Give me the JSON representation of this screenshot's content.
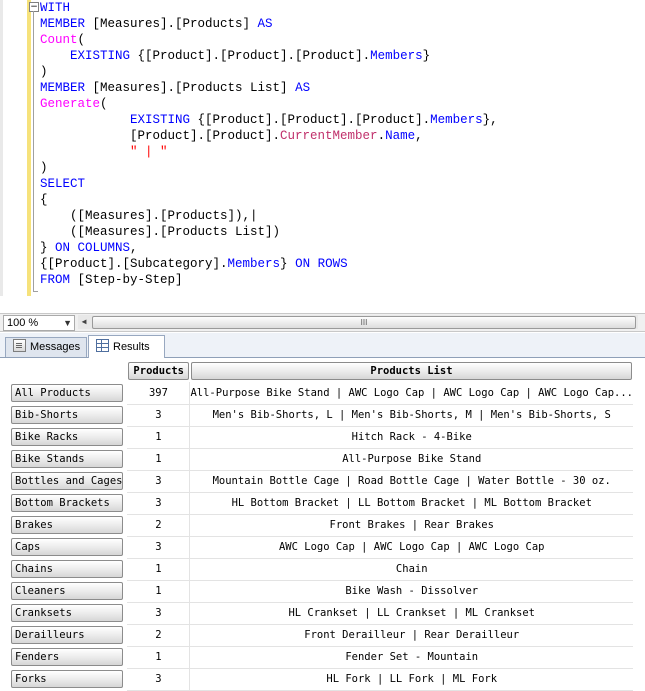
{
  "editor": {
    "fold_symbol": "−",
    "lines": [
      [
        {
          "t": "WITH",
          "c": "kw"
        }
      ],
      [
        {
          "t": "MEMBER",
          "c": "kw"
        },
        {
          "t": " [Measures].[Products] "
        },
        {
          "t": "AS",
          "c": "kw"
        }
      ],
      [
        {
          "t": "Count",
          "c": "fn"
        },
        {
          "t": "("
        }
      ],
      [
        {
          "t": "    "
        },
        {
          "t": "EXISTING",
          "c": "kw"
        },
        {
          "t": " {[Product].[Product].[Product]."
        },
        {
          "t": "Members",
          "c": "kw"
        },
        {
          "t": "}"
        }
      ],
      [
        {
          "t": ")"
        }
      ],
      [
        {
          "t": "MEMBER",
          "c": "kw"
        },
        {
          "t": " [Measures].[Products List] "
        },
        {
          "t": "AS",
          "c": "kw"
        }
      ],
      [
        {
          "t": "Generate",
          "c": "fn"
        },
        {
          "t": "("
        }
      ],
      [
        {
          "t": "            "
        },
        {
          "t": "EXISTING",
          "c": "kw"
        },
        {
          "t": " {[Product].[Product].[Product]."
        },
        {
          "t": "Members",
          "c": "kw"
        },
        {
          "t": "},"
        }
      ],
      [
        {
          "t": "            [Product].[Product]."
        },
        {
          "t": "CurrentMember",
          "c": "fnx"
        },
        {
          "t": "."
        },
        {
          "t": "Name",
          "c": "kw"
        },
        {
          "t": ","
        }
      ],
      [
        {
          "t": "            "
        },
        {
          "t": "\" | \"",
          "c": "st"
        }
      ],
      [
        {
          "t": ")"
        }
      ],
      [
        {
          "t": "SELECT",
          "c": "kw"
        }
      ],
      [
        {
          "t": "{"
        }
      ],
      [
        {
          "t": "    ([Measures].[Products]),|"
        }
      ],
      [
        {
          "t": "    ([Measures].[Products List])"
        }
      ],
      [
        {
          "t": "} "
        },
        {
          "t": "ON COLUMNS",
          "c": "kw"
        },
        {
          "t": ","
        }
      ],
      [
        {
          "t": "{[Product].[Subcategory]."
        },
        {
          "t": "Members",
          "c": "kw"
        },
        {
          "t": "} "
        },
        {
          "t": "ON ROWS",
          "c": "kw"
        }
      ],
      [
        {
          "t": "FROM",
          "c": "kw"
        },
        {
          "t": " [Step-by-Step]"
        }
      ]
    ]
  },
  "zoom": {
    "value": "100 %",
    "arrow": "▼"
  },
  "hscroll": {
    "left_arrow": "◀",
    "thumb_grip": "III"
  },
  "tabs": {
    "messages": "Messages",
    "results": "Results"
  },
  "grid": {
    "columns": [
      "Products",
      "Products List"
    ],
    "rows": [
      {
        "name": "All Products",
        "products": "397",
        "list": "All-Purpose Bike Stand | AWC Logo Cap | AWC Logo Cap | AWC Logo Cap..."
      },
      {
        "name": "Bib-Shorts",
        "products": "3",
        "list": "Men's Bib-Shorts, L | Men's Bib-Shorts, M | Men's Bib-Shorts, S"
      },
      {
        "name": "Bike Racks",
        "products": "1",
        "list": "Hitch Rack - 4-Bike"
      },
      {
        "name": "Bike Stands",
        "products": "1",
        "list": "All-Purpose Bike Stand"
      },
      {
        "name": "Bottles and Cages",
        "products": "3",
        "list": "Mountain Bottle Cage | Road Bottle Cage | Water Bottle - 30 oz."
      },
      {
        "name": "Bottom Brackets",
        "products": "3",
        "list": "HL Bottom Bracket | LL Bottom Bracket | ML Bottom Bracket"
      },
      {
        "name": "Brakes",
        "products": "2",
        "list": "Front Brakes | Rear Brakes"
      },
      {
        "name": "Caps",
        "products": "3",
        "list": "AWC Logo Cap | AWC Logo Cap | AWC Logo Cap"
      },
      {
        "name": "Chains",
        "products": "1",
        "list": "Chain"
      },
      {
        "name": "Cleaners",
        "products": "1",
        "list": "Bike Wash - Dissolver"
      },
      {
        "name": "Cranksets",
        "products": "3",
        "list": "HL Crankset | LL Crankset | ML Crankset"
      },
      {
        "name": "Derailleurs",
        "products": "2",
        "list": "Front Derailleur | Rear Derailleur"
      },
      {
        "name": "Fenders",
        "products": "1",
        "list": "Fender Set - Mountain"
      },
      {
        "name": "Forks",
        "products": "3",
        "list": "HL Fork | LL Fork | ML Fork"
      }
    ]
  }
}
